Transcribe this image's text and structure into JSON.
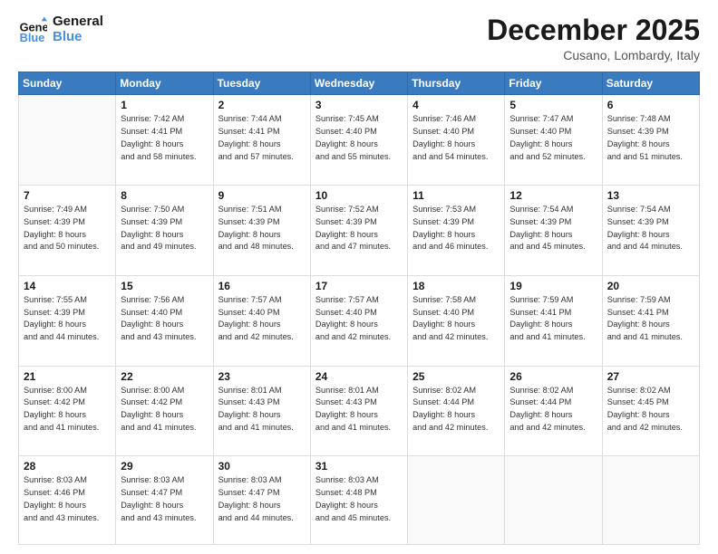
{
  "header": {
    "logo_general": "General",
    "logo_blue": "Blue",
    "title": "December 2025",
    "subtitle": "Cusano, Lombardy, Italy"
  },
  "days_of_week": [
    "Sunday",
    "Monday",
    "Tuesday",
    "Wednesday",
    "Thursday",
    "Friday",
    "Saturday"
  ],
  "weeks": [
    [
      {
        "day": "",
        "sunrise": "",
        "sunset": "",
        "daylight": ""
      },
      {
        "day": "1",
        "sunrise": "Sunrise: 7:42 AM",
        "sunset": "Sunset: 4:41 PM",
        "daylight": "Daylight: 8 hours and 58 minutes."
      },
      {
        "day": "2",
        "sunrise": "Sunrise: 7:44 AM",
        "sunset": "Sunset: 4:41 PM",
        "daylight": "Daylight: 8 hours and 57 minutes."
      },
      {
        "day": "3",
        "sunrise": "Sunrise: 7:45 AM",
        "sunset": "Sunset: 4:40 PM",
        "daylight": "Daylight: 8 hours and 55 minutes."
      },
      {
        "day": "4",
        "sunrise": "Sunrise: 7:46 AM",
        "sunset": "Sunset: 4:40 PM",
        "daylight": "Daylight: 8 hours and 54 minutes."
      },
      {
        "day": "5",
        "sunrise": "Sunrise: 7:47 AM",
        "sunset": "Sunset: 4:40 PM",
        "daylight": "Daylight: 8 hours and 52 minutes."
      },
      {
        "day": "6",
        "sunrise": "Sunrise: 7:48 AM",
        "sunset": "Sunset: 4:39 PM",
        "daylight": "Daylight: 8 hours and 51 minutes."
      }
    ],
    [
      {
        "day": "7",
        "sunrise": "Sunrise: 7:49 AM",
        "sunset": "Sunset: 4:39 PM",
        "daylight": "Daylight: 8 hours and 50 minutes."
      },
      {
        "day": "8",
        "sunrise": "Sunrise: 7:50 AM",
        "sunset": "Sunset: 4:39 PM",
        "daylight": "Daylight: 8 hours and 49 minutes."
      },
      {
        "day": "9",
        "sunrise": "Sunrise: 7:51 AM",
        "sunset": "Sunset: 4:39 PM",
        "daylight": "Daylight: 8 hours and 48 minutes."
      },
      {
        "day": "10",
        "sunrise": "Sunrise: 7:52 AM",
        "sunset": "Sunset: 4:39 PM",
        "daylight": "Daylight: 8 hours and 47 minutes."
      },
      {
        "day": "11",
        "sunrise": "Sunrise: 7:53 AM",
        "sunset": "Sunset: 4:39 PM",
        "daylight": "Daylight: 8 hours and 46 minutes."
      },
      {
        "day": "12",
        "sunrise": "Sunrise: 7:54 AM",
        "sunset": "Sunset: 4:39 PM",
        "daylight": "Daylight: 8 hours and 45 minutes."
      },
      {
        "day": "13",
        "sunrise": "Sunrise: 7:54 AM",
        "sunset": "Sunset: 4:39 PM",
        "daylight": "Daylight: 8 hours and 44 minutes."
      }
    ],
    [
      {
        "day": "14",
        "sunrise": "Sunrise: 7:55 AM",
        "sunset": "Sunset: 4:39 PM",
        "daylight": "Daylight: 8 hours and 44 minutes."
      },
      {
        "day": "15",
        "sunrise": "Sunrise: 7:56 AM",
        "sunset": "Sunset: 4:40 PM",
        "daylight": "Daylight: 8 hours and 43 minutes."
      },
      {
        "day": "16",
        "sunrise": "Sunrise: 7:57 AM",
        "sunset": "Sunset: 4:40 PM",
        "daylight": "Daylight: 8 hours and 42 minutes."
      },
      {
        "day": "17",
        "sunrise": "Sunrise: 7:57 AM",
        "sunset": "Sunset: 4:40 PM",
        "daylight": "Daylight: 8 hours and 42 minutes."
      },
      {
        "day": "18",
        "sunrise": "Sunrise: 7:58 AM",
        "sunset": "Sunset: 4:40 PM",
        "daylight": "Daylight: 8 hours and 42 minutes."
      },
      {
        "day": "19",
        "sunrise": "Sunrise: 7:59 AM",
        "sunset": "Sunset: 4:41 PM",
        "daylight": "Daylight: 8 hours and 41 minutes."
      },
      {
        "day": "20",
        "sunrise": "Sunrise: 7:59 AM",
        "sunset": "Sunset: 4:41 PM",
        "daylight": "Daylight: 8 hours and 41 minutes."
      }
    ],
    [
      {
        "day": "21",
        "sunrise": "Sunrise: 8:00 AM",
        "sunset": "Sunset: 4:42 PM",
        "daylight": "Daylight: 8 hours and 41 minutes."
      },
      {
        "day": "22",
        "sunrise": "Sunrise: 8:00 AM",
        "sunset": "Sunset: 4:42 PM",
        "daylight": "Daylight: 8 hours and 41 minutes."
      },
      {
        "day": "23",
        "sunrise": "Sunrise: 8:01 AM",
        "sunset": "Sunset: 4:43 PM",
        "daylight": "Daylight: 8 hours and 41 minutes."
      },
      {
        "day": "24",
        "sunrise": "Sunrise: 8:01 AM",
        "sunset": "Sunset: 4:43 PM",
        "daylight": "Daylight: 8 hours and 41 minutes."
      },
      {
        "day": "25",
        "sunrise": "Sunrise: 8:02 AM",
        "sunset": "Sunset: 4:44 PM",
        "daylight": "Daylight: 8 hours and 42 minutes."
      },
      {
        "day": "26",
        "sunrise": "Sunrise: 8:02 AM",
        "sunset": "Sunset: 4:44 PM",
        "daylight": "Daylight: 8 hours and 42 minutes."
      },
      {
        "day": "27",
        "sunrise": "Sunrise: 8:02 AM",
        "sunset": "Sunset: 4:45 PM",
        "daylight": "Daylight: 8 hours and 42 minutes."
      }
    ],
    [
      {
        "day": "28",
        "sunrise": "Sunrise: 8:03 AM",
        "sunset": "Sunset: 4:46 PM",
        "daylight": "Daylight: 8 hours and 43 minutes."
      },
      {
        "day": "29",
        "sunrise": "Sunrise: 8:03 AM",
        "sunset": "Sunset: 4:47 PM",
        "daylight": "Daylight: 8 hours and 43 minutes."
      },
      {
        "day": "30",
        "sunrise": "Sunrise: 8:03 AM",
        "sunset": "Sunset: 4:47 PM",
        "daylight": "Daylight: 8 hours and 44 minutes."
      },
      {
        "day": "31",
        "sunrise": "Sunrise: 8:03 AM",
        "sunset": "Sunset: 4:48 PM",
        "daylight": "Daylight: 8 hours and 45 minutes."
      },
      {
        "day": "",
        "sunrise": "",
        "sunset": "",
        "daylight": ""
      },
      {
        "day": "",
        "sunrise": "",
        "sunset": "",
        "daylight": ""
      },
      {
        "day": "",
        "sunrise": "",
        "sunset": "",
        "daylight": ""
      }
    ]
  ]
}
